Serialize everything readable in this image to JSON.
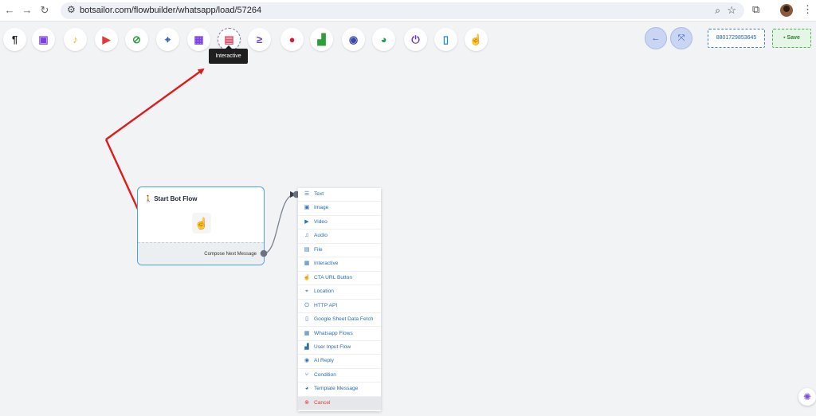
{
  "browser": {
    "url": "botsailor.com/flowbuilder/whatsapp/load/57264"
  },
  "toolbar": {
    "tools": [
      {
        "name": "text-tool",
        "icon": "pilcrow-icon",
        "glyph": "¶",
        "color": "#222222"
      },
      {
        "name": "image-tool",
        "icon": "image-icon",
        "glyph": "▣",
        "color": "#7b3fe4"
      },
      {
        "name": "audio-tool",
        "icon": "microphone-icon",
        "glyph": "♪",
        "color": "#f2b705"
      },
      {
        "name": "video-tool",
        "icon": "youtube-icon",
        "glyph": "▶",
        "color": "#e53935"
      },
      {
        "name": "file-tool",
        "icon": "paperclip-icon",
        "glyph": "⊘",
        "color": "#2e9d3a"
      },
      {
        "name": "location-tool",
        "icon": "map-icon",
        "glyph": "⌖",
        "color": "#2b5fb3"
      },
      {
        "name": "whatsapp-flows-tool",
        "icon": "frame-icon",
        "glyph": "▦",
        "color": "#7b3fe4"
      },
      {
        "name": "interactive-tool",
        "icon": "newspaper-icon",
        "glyph": "▤",
        "color": "#e0455f"
      },
      {
        "name": "condition-tool",
        "icon": "greater-equal-icon",
        "glyph": "≥",
        "color": "#6a3fb8"
      },
      {
        "name": "ai-reply-tool",
        "icon": "drop-icon",
        "glyph": "●",
        "color": "#d81b3c"
      },
      {
        "name": "user-input-tool",
        "icon": "chart-icon",
        "glyph": "▟",
        "color": "#2e9d3a"
      },
      {
        "name": "bot-tool",
        "icon": "robot-icon",
        "glyph": "◉",
        "color": "#3949ab"
      },
      {
        "name": "template-tool",
        "icon": "palette-icon",
        "glyph": "◕",
        "color": "#11a54b"
      },
      {
        "name": "http-api-tool",
        "icon": "plug-icon",
        "glyph": "⏻",
        "color": "#6a2fd6"
      },
      {
        "name": "sheet-tool",
        "icon": "document-icon",
        "glyph": "▯",
        "color": "#1e88e5"
      },
      {
        "name": "cta-tool",
        "icon": "pointer-icon",
        "glyph": "☝",
        "color": "#7b4fa8"
      }
    ],
    "tooltip": "Interactive",
    "back_icon": "←",
    "fit_icon": "⤧",
    "phone": "8801729853645",
    "save_label": "Save",
    "save_icon": "▪"
  },
  "start_node": {
    "title": "Start Bot Flow",
    "icon": "person-walking-icon",
    "footer": "Compose Next Message"
  },
  "menu": {
    "items": [
      {
        "label": "Text",
        "glyph": "☰"
      },
      {
        "label": "Image",
        "glyph": "▣"
      },
      {
        "label": "Video",
        "glyph": "▶"
      },
      {
        "label": "Audio",
        "glyph": "♫"
      },
      {
        "label": "File",
        "glyph": "▤"
      },
      {
        "label": "Interactive",
        "glyph": "▦"
      },
      {
        "label": "CTA URL Button",
        "glyph": "☝"
      },
      {
        "label": "Location",
        "glyph": "⌖"
      },
      {
        "label": "HTTP API",
        "glyph": "⏻"
      },
      {
        "label": "Google Sheet Data Fetch",
        "glyph": "▯"
      },
      {
        "label": "Whatsapp Flows",
        "glyph": "▦"
      },
      {
        "label": "User Input Flow",
        "glyph": "▟"
      },
      {
        "label": "AI Reply",
        "glyph": "◉"
      },
      {
        "label": "Condition",
        "glyph": "⑂"
      },
      {
        "label": "Template Message",
        "glyph": "◕"
      },
      {
        "label": "Cancel",
        "glyph": "⊗"
      }
    ]
  },
  "colors": {
    "annotation_arrow": "#e01b1b",
    "node_border": "#4aa3df",
    "connector": "#7a8391"
  }
}
